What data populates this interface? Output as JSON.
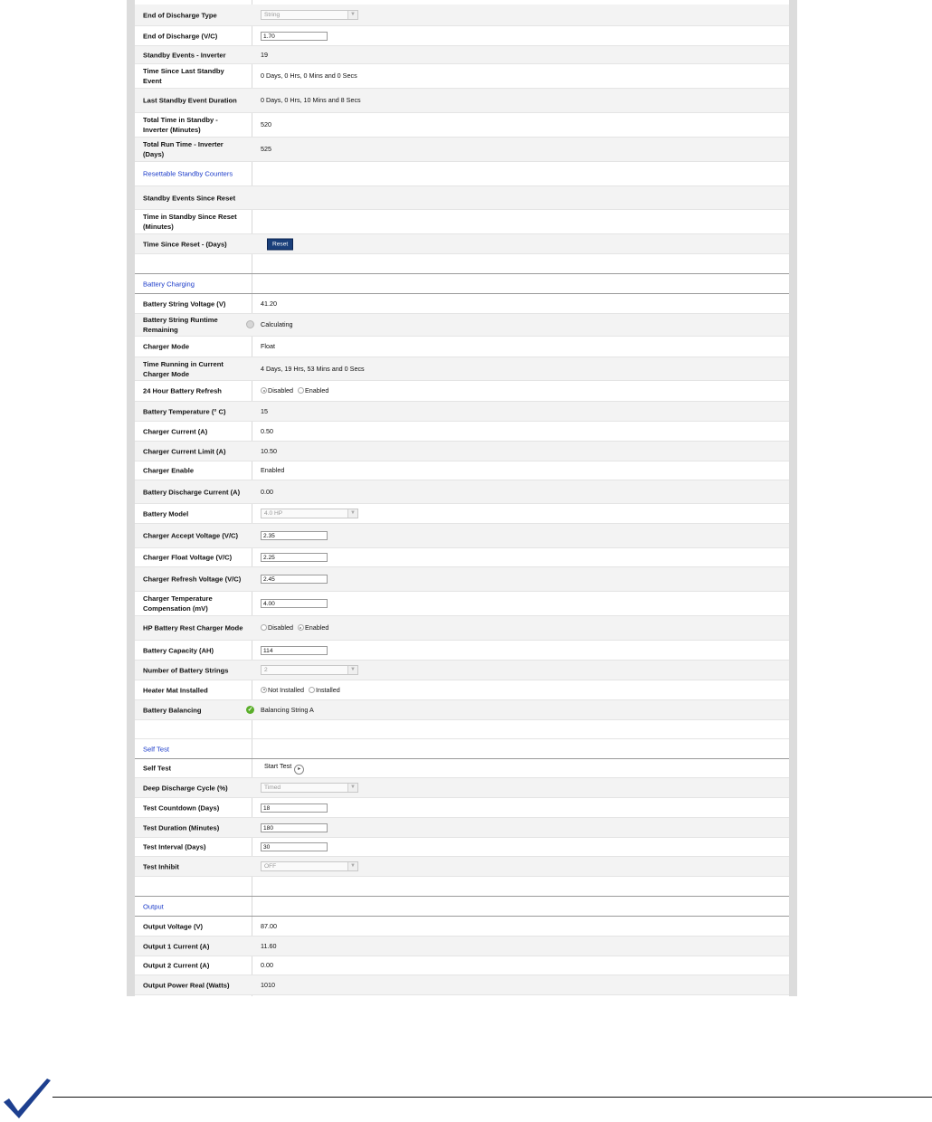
{
  "standby": {
    "rows": [
      {
        "label": "End of Discharge Type",
        "type": "select",
        "value": "String"
      },
      {
        "label": "End of Discharge (V/C)",
        "type": "input",
        "value": "1.70"
      },
      {
        "label": "Standby Events - Inverter",
        "type": "text",
        "value": "19"
      },
      {
        "label": "Time Since Last Standby Event",
        "type": "text",
        "value": "0 Days, 0 Hrs, 0 Mins and 0 Secs"
      },
      {
        "label": "Last Standby Event Duration",
        "type": "text",
        "value": "0 Days, 0 Hrs, 10 Mins and 8 Secs"
      },
      {
        "label": "Total Time in Standby - Inverter (Minutes)",
        "type": "text",
        "value": "520"
      },
      {
        "label": "Total Run Time - Inverter (Days)",
        "type": "text",
        "value": "525"
      },
      {
        "label": "Resettable Standby Counters",
        "type": "section"
      },
      {
        "label": "Standby Events Since Reset",
        "type": "text",
        "value": ""
      },
      {
        "label": "Time in Standby Since Reset (Minutes)",
        "type": "text",
        "value": ""
      },
      {
        "label": "Time Since Reset - (Days)",
        "type": "button",
        "value": "Reset"
      }
    ]
  },
  "battery_charging": {
    "title": "Battery Charging",
    "rows": [
      {
        "label": "Battery String Voltage (V)",
        "type": "text",
        "value": "41.20"
      },
      {
        "label": "Battery String Runtime Remaining",
        "type": "text",
        "value": "Calculating",
        "icon": "info-icon"
      },
      {
        "label": "Charger Mode",
        "type": "text",
        "value": "Float"
      },
      {
        "label": "Time Running in Current Charger Mode",
        "type": "text",
        "value": "4 Days, 19 Hrs, 53 Mins and 0 Secs"
      },
      {
        "label": "24 Hour Battery Refresh",
        "type": "radio",
        "options": [
          "Disabled",
          "Enabled"
        ],
        "selected": 0
      },
      {
        "label": "Battery Temperature (° C)",
        "type": "text",
        "value": "15"
      },
      {
        "label": "Charger Current (A)",
        "type": "text",
        "value": "0.50"
      },
      {
        "label": "Charger Current Limit (A)",
        "type": "text",
        "value": "10.50"
      },
      {
        "label": "Charger Enable",
        "type": "text",
        "value": "Enabled"
      },
      {
        "label": "Battery Discharge Current (A)",
        "type": "text",
        "value": "0.00"
      },
      {
        "label": "Battery Model",
        "type": "select",
        "value": "4.0 HP"
      },
      {
        "label": "Charger Accept Voltage (V/C)",
        "type": "input",
        "value": "2.35"
      },
      {
        "label": "Charger Float Voltage (V/C)",
        "type": "input",
        "value": "2.25"
      },
      {
        "label": "Charger Refresh Voltage (V/C)",
        "type": "input",
        "value": "2.45"
      },
      {
        "label": "Charger Temperature Compensation (mV)",
        "type": "input",
        "value": "4.00"
      },
      {
        "label": "HP Battery Rest Charger Mode",
        "type": "radio",
        "options": [
          "Disabled",
          "Enabled"
        ],
        "selected": 1
      },
      {
        "label": "Battery Capacity (AH)",
        "type": "input",
        "value": "114"
      },
      {
        "label": "Number of Battery Strings",
        "type": "select",
        "value": "2"
      },
      {
        "label": "Heater Mat Installed",
        "type": "radio",
        "options": [
          "Not Installed",
          "Installed"
        ],
        "selected": 0
      },
      {
        "label": "Battery Balancing",
        "type": "text",
        "value": "Balancing String A",
        "icon": "ok-icon"
      }
    ]
  },
  "self_test": {
    "title": "Self Test",
    "rows": [
      {
        "label": "Self Test",
        "type": "action",
        "value": "Start Test"
      },
      {
        "label": "Deep Discharge Cycle (%)",
        "type": "select",
        "value": "Timed"
      },
      {
        "label": "Test Countdown (Days)",
        "type": "input",
        "value": "18"
      },
      {
        "label": "Test Duration (Minutes)",
        "type": "input",
        "value": "180"
      },
      {
        "label": "Test Interval (Days)",
        "type": "input",
        "value": "30"
      },
      {
        "label": "Test Inhibit",
        "type": "select",
        "value": "OFF"
      }
    ]
  },
  "output": {
    "title": "Output",
    "rows": [
      {
        "label": "Output Voltage (V)",
        "type": "text",
        "value": "87.00"
      },
      {
        "label": "Output 1 Current (A)",
        "type": "text",
        "value": "11.60"
      },
      {
        "label": "Output 2 Current (A)",
        "type": "text",
        "value": "0.00"
      },
      {
        "label": "Output Power Real (Watts)",
        "type": "text",
        "value": "1010"
      }
    ]
  },
  "colors": {
    "section_heading": "#1a3ac9",
    "reset_button": "#1a3f7a",
    "ok_icon": "#5aae2a",
    "checkmark": "#1d3f8f"
  }
}
